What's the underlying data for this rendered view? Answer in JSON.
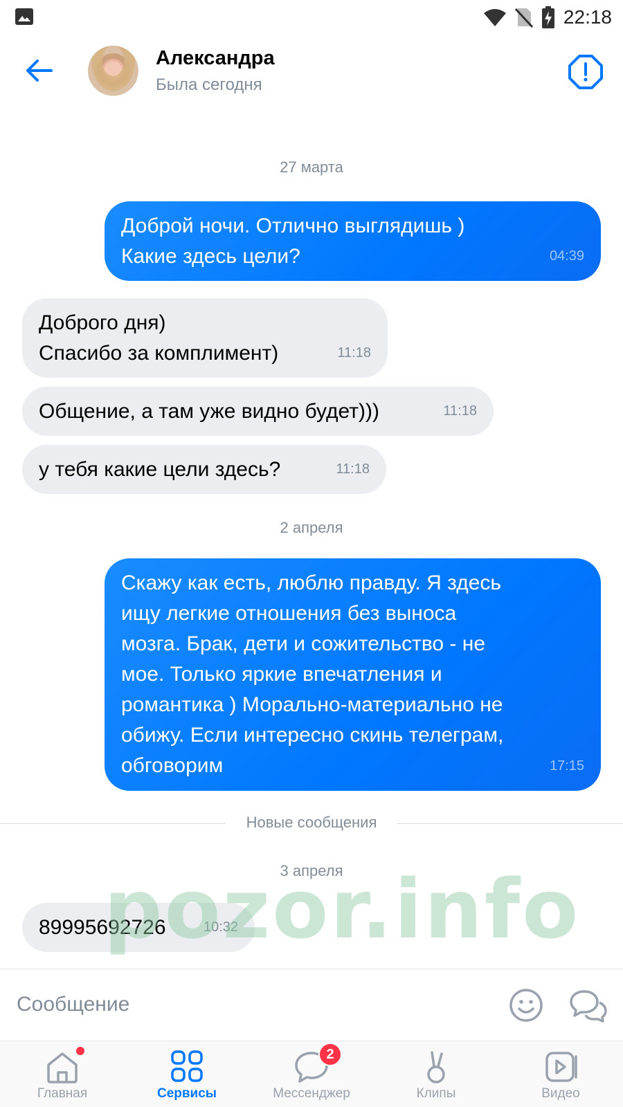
{
  "status_bar": {
    "time": "22:18"
  },
  "header": {
    "contact_name": "Александра",
    "contact_status": "Была сегодня"
  },
  "chat": {
    "date_1": "27 марта",
    "msg_1": {
      "text": "Доброй ночи. Отлично выглядишь )\nКакие здесь цели?",
      "time": "04:39"
    },
    "msg_2": {
      "text": "Доброго дня)\nСпасибо за комплимент)",
      "time": "11:18"
    },
    "msg_3": {
      "text": "Общение, а там уже видно будет)))",
      "time": "11:18"
    },
    "msg_4": {
      "text": "у тебя какие цели здесь?",
      "time": "11:18"
    },
    "date_2": "2 апреля",
    "msg_5": {
      "text": "Скажу как есть, люблю правду. Я здесь\nищу легкие отношения без выноса\nмозга. Брак, дети и сожительство - не\nмое. Только яркие впечатления и\nромантика ) Морально-материально не\nобижу. Если интересно скинь телеграм,\nобговорим",
      "time": "17:15"
    },
    "new_messages_label": "Новые сообщения",
    "date_3": "3 апреля",
    "msg_6": {
      "text": "89995692726",
      "time": "10:32"
    },
    "watermark": "pozor.info"
  },
  "composer": {
    "placeholder": "Сообщение"
  },
  "tabbar": {
    "home": "Главная",
    "services": "Сервисы",
    "messenger": "Мессенджер",
    "messenger_badge": "2",
    "clips": "Клипы",
    "video": "Видео"
  },
  "colors": {
    "accent": "#0077ff",
    "outgoing_bubble": "#0a7df8",
    "incoming_bubble": "#ebedf0",
    "secondary_text": "#818c99",
    "badge": "#ff3347"
  }
}
